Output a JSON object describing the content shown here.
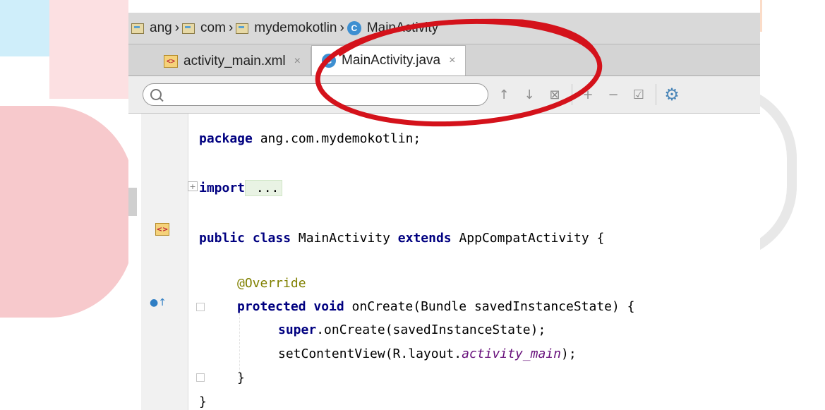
{
  "breadcrumb": {
    "items": [
      "ang",
      "com",
      "mydemokotlin",
      "MainActivity"
    ]
  },
  "tabs": [
    {
      "label": "activity_main.xml",
      "close": "×"
    },
    {
      "label": "MainActivity.java",
      "close": "×"
    }
  ],
  "search": {
    "value": "",
    "placeholder": ""
  },
  "toolbar_icons": [
    "arrow-up-icon",
    "arrow-down-icon",
    "find-all-icon",
    "add-occurrence-icon",
    "remove-occurrence-icon",
    "select-all-icon",
    "settings-gear-icon"
  ],
  "class_icon_letter": "C",
  "xml_icon_text": "<>",
  "code": {
    "line1_kw": "package",
    "line1_rest": " ang.com.mydemokotlin;",
    "line2_kw": "import",
    "line2_rest": " ...",
    "line3_kw1": "public class",
    "line3_mid": " MainActivity ",
    "line3_kw2": "extends",
    "line3_rest": " AppCompatActivity {",
    "line4_ann": "@Override",
    "line5_kw": "protected void",
    "line5_rest": " onCreate(Bundle savedInstanceState) {",
    "line6_kw": "super",
    "line6_rest": ".onCreate(savedInstanceState);",
    "line7_pre": "setContentView(R.layout.",
    "line7_field": "activity_main",
    "line7_post": ");",
    "line8": "}",
    "line9": "}"
  },
  "colors": {
    "annotation_ellipse": "#d4121b",
    "keyword": "#000080",
    "annotation": "#808000",
    "field": "#660e7a"
  }
}
